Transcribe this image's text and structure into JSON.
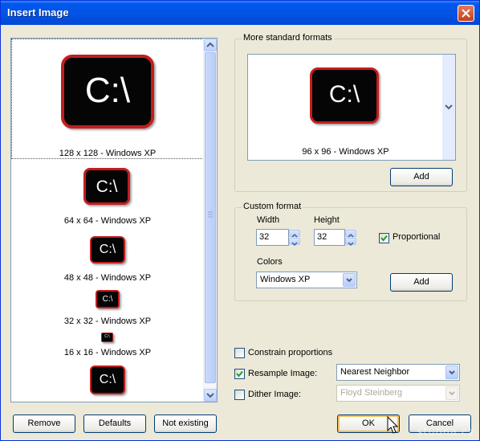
{
  "window": {
    "title": "Insert Image"
  },
  "icons": [
    {
      "caption": "128 x 128 - Windows XP",
      "text": "C:\\",
      "selected": true
    },
    {
      "caption": "64 x 64 - Windows XP",
      "text": "C:\\"
    },
    {
      "caption": "48 x 48 - Windows XP",
      "text": "C:\\"
    },
    {
      "caption": "32 x 32 - Windows XP",
      "text": "C:\\"
    },
    {
      "caption": "16 x 16 - Windows XP",
      "text": "C:\\"
    },
    {
      "caption": "",
      "text": "C:\\"
    }
  ],
  "standard": {
    "group_label": "More standard formats",
    "preview_caption": "96 x 96 - Windows XP",
    "preview_text": "C:\\",
    "add_label": "Add"
  },
  "custom": {
    "group_label": "Custom format",
    "width_label": "Width",
    "width_value": "32",
    "height_label": "Height",
    "height_value": "32",
    "proportional_label": "Proportional",
    "proportional_checked": true,
    "colors_label": "Colors",
    "colors_value": "Windows XP",
    "add_label": "Add"
  },
  "options": {
    "constrain_label": "Constrain proportions",
    "constrain_checked": false,
    "resample_label": "Resample Image:",
    "resample_checked": true,
    "resample_value": "Nearest Neighbor",
    "dither_label": "Dither Image:",
    "dither_checked": false,
    "dither_value": "Floyd Steinberg"
  },
  "buttons": {
    "remove": "Remove",
    "defaults": "Defaults",
    "not_existing": "Not existing",
    "ok": "OK",
    "cancel": "Cancel"
  },
  "watermark": "stuona.cz",
  "colors": {
    "titlebar": "#0453e4",
    "icon_border": "#c31e1e",
    "dialog_bg": "#ece9d8"
  }
}
